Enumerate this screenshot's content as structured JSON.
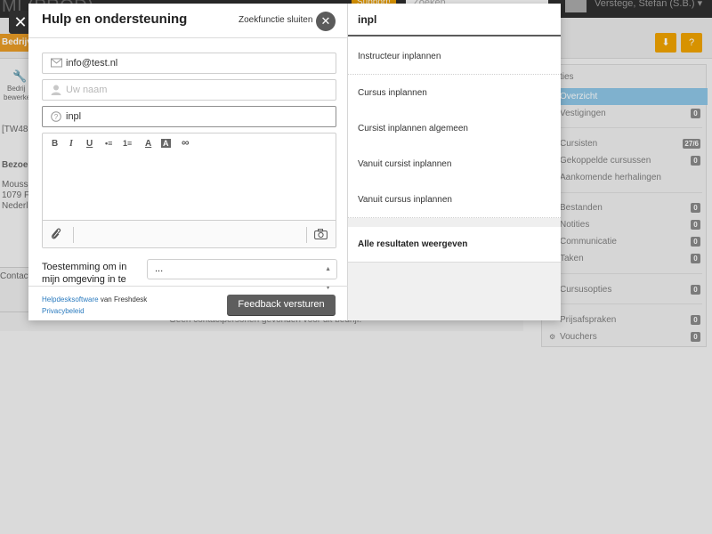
{
  "background": {
    "app_title": "MI (PROD)",
    "support_badge": "Support!",
    "search_placeholder": "Zoeken",
    "user_name": "Verstege, Stefan (S.B.)",
    "active_tab": "Bedrijv",
    "left_snips": [
      "Bedrij",
      "bewerke",
      "[TW481",
      "Bezoek",
      "Moussa",
      "1079 F",
      "Nederla",
      "Contact"
    ],
    "empty_message": "Geen contactpersonen gevonden voor dit bedrijf.",
    "panel_header": "ties",
    "panel_items": [
      {
        "label": "Overzicht",
        "count": "",
        "active": true
      },
      {
        "label": "Vestigingen",
        "count": "0",
        "active": false
      },
      {
        "label": "Cursisten",
        "count": "27/6",
        "active": false
      },
      {
        "label": "Gekoppelde cursussen",
        "count": "0",
        "active": false
      },
      {
        "label": "Aankomende herhalingen",
        "count": "",
        "active": false
      },
      {
        "label": "Bestanden",
        "count": "0",
        "active": false
      },
      {
        "label": "Notities",
        "count": "0",
        "active": false
      },
      {
        "label": "Communicatie",
        "count": "0",
        "active": false
      },
      {
        "label": "Taken",
        "count": "0",
        "active": false
      },
      {
        "label": "Cursusopties",
        "count": "0",
        "active": false
      },
      {
        "label": "Prijsafspraken",
        "count": "0",
        "active": false
      },
      {
        "label": "Vouchers",
        "count": "0",
        "active": false
      }
    ]
  },
  "widget": {
    "title": "Hulp en ondersteuning",
    "close_search": "Zoekfunctie sluiten",
    "email_value": "info@test.nl",
    "name_placeholder": "Uw naam",
    "subject_value": "inpl",
    "toolbar": [
      "B",
      "I",
      "U",
      "•≡",
      "1≡",
      "A",
      "A",
      "∞"
    ],
    "consent_label": "Toestemming om in mijn omgeving in te",
    "consent_value": "...",
    "footer_link": "Helpdesksoftware",
    "footer_text": " van Freshdesk",
    "privacy_link": "Privacybeleid",
    "send_button": "Feedback versturen"
  },
  "search": {
    "query": "inpl",
    "results": [
      "Instructeur inplannen",
      "Cursus inplannen",
      "Cursist inplannen algemeen",
      "Vanuit cursist inplannen",
      "Vanuit cursus inplannen"
    ],
    "all_results": "Alle resultaten weergeven"
  }
}
